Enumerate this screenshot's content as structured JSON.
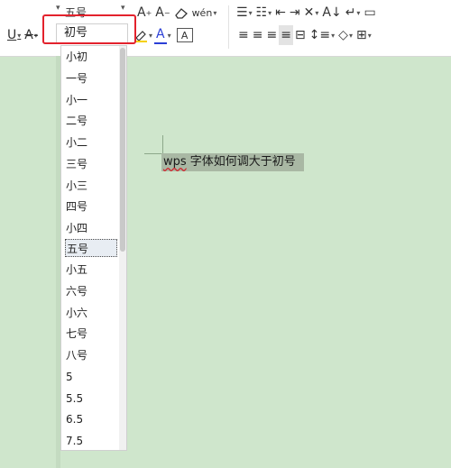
{
  "toolbar": {
    "font_size_current": "五号",
    "font_size_input": "初号",
    "increase_font_label": "A",
    "decrease_font_label": "A",
    "pinyin_label": "wén",
    "font_color_label": "A",
    "char_border_label": "A"
  },
  "font_size_options": [
    "小初",
    "一号",
    "小一",
    "二号",
    "小二",
    "三号",
    "小三",
    "四号",
    "小四",
    "五号",
    "小五",
    "六号",
    "小六",
    "七号",
    "八号",
    "5",
    "5.5",
    "6.5",
    "7.5"
  ],
  "selected_option": "五号",
  "document": {
    "text_word": "wps",
    "text_rest": " 字体如何调大于初号"
  },
  "colors": {
    "highlight_border": "#e3222d",
    "page_bg": "#cfe6cc",
    "selection_bg": "#a9b8a4"
  }
}
